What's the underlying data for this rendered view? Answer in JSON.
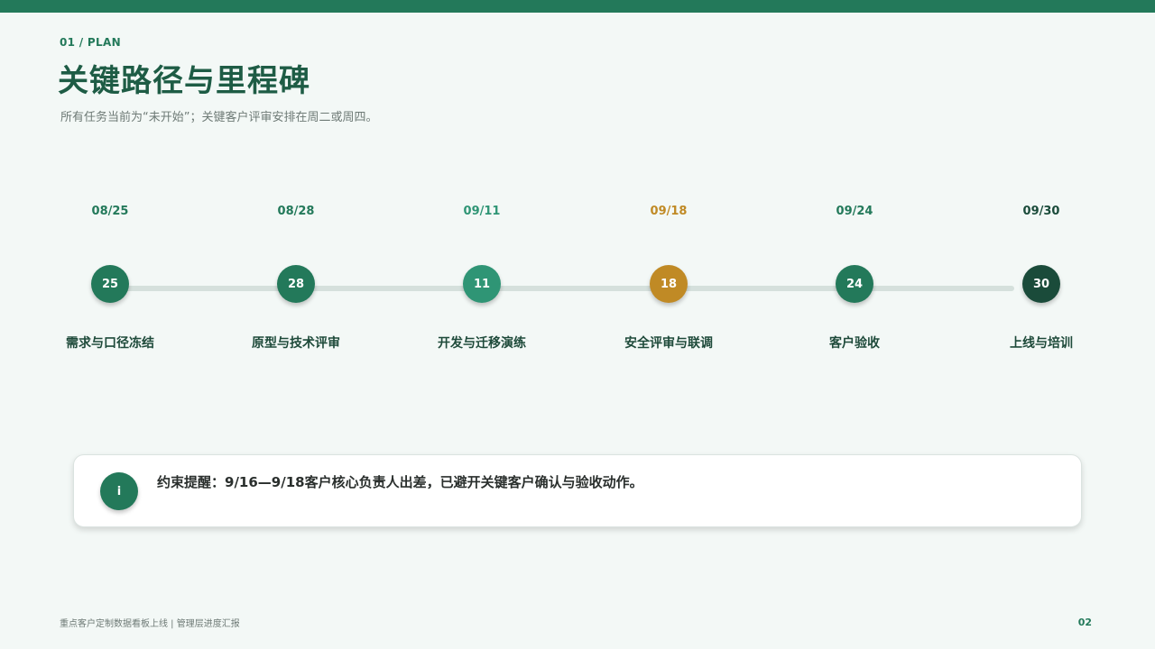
{
  "header": {
    "section_label": "01 / PLAN",
    "title": "关键路径与里程碑",
    "subtitle": "所有任务当前为“未开始”；关键客户评审安排在周二或周四。"
  },
  "timeline": {
    "milestones": [
      {
        "date": "08/25",
        "day": "25",
        "label": "需求与口径冻结",
        "color": "#23795a"
      },
      {
        "date": "08/28",
        "day": "28",
        "label": "原型与技术评审",
        "color": "#23795a"
      },
      {
        "date": "09/11",
        "day": "11",
        "label": "开发与迁移演练",
        "color": "#2f9575"
      },
      {
        "date": "09/18",
        "day": "18",
        "label": "安全评审与联调",
        "color": "#c08a25"
      },
      {
        "date": "09/24",
        "day": "24",
        "label": "客户验收",
        "color": "#23795a"
      },
      {
        "date": "09/30",
        "day": "30",
        "label": "上线与培训",
        "color": "#1a4b3a"
      }
    ]
  },
  "note": {
    "icon": "i",
    "text": "约束提醒：9/16—9/18客户核心负责人出差，已避开关键客户确认与验收动作。"
  },
  "footer": {
    "left": "重点客户定制数据看板上线 | 管理层进度汇报",
    "page_number": "02"
  },
  "colors": {
    "accent": "#23795a",
    "title": "#1e5c45",
    "warning": "#c08a25",
    "dark": "#1a4b3a",
    "track": "#d5e0dc"
  }
}
